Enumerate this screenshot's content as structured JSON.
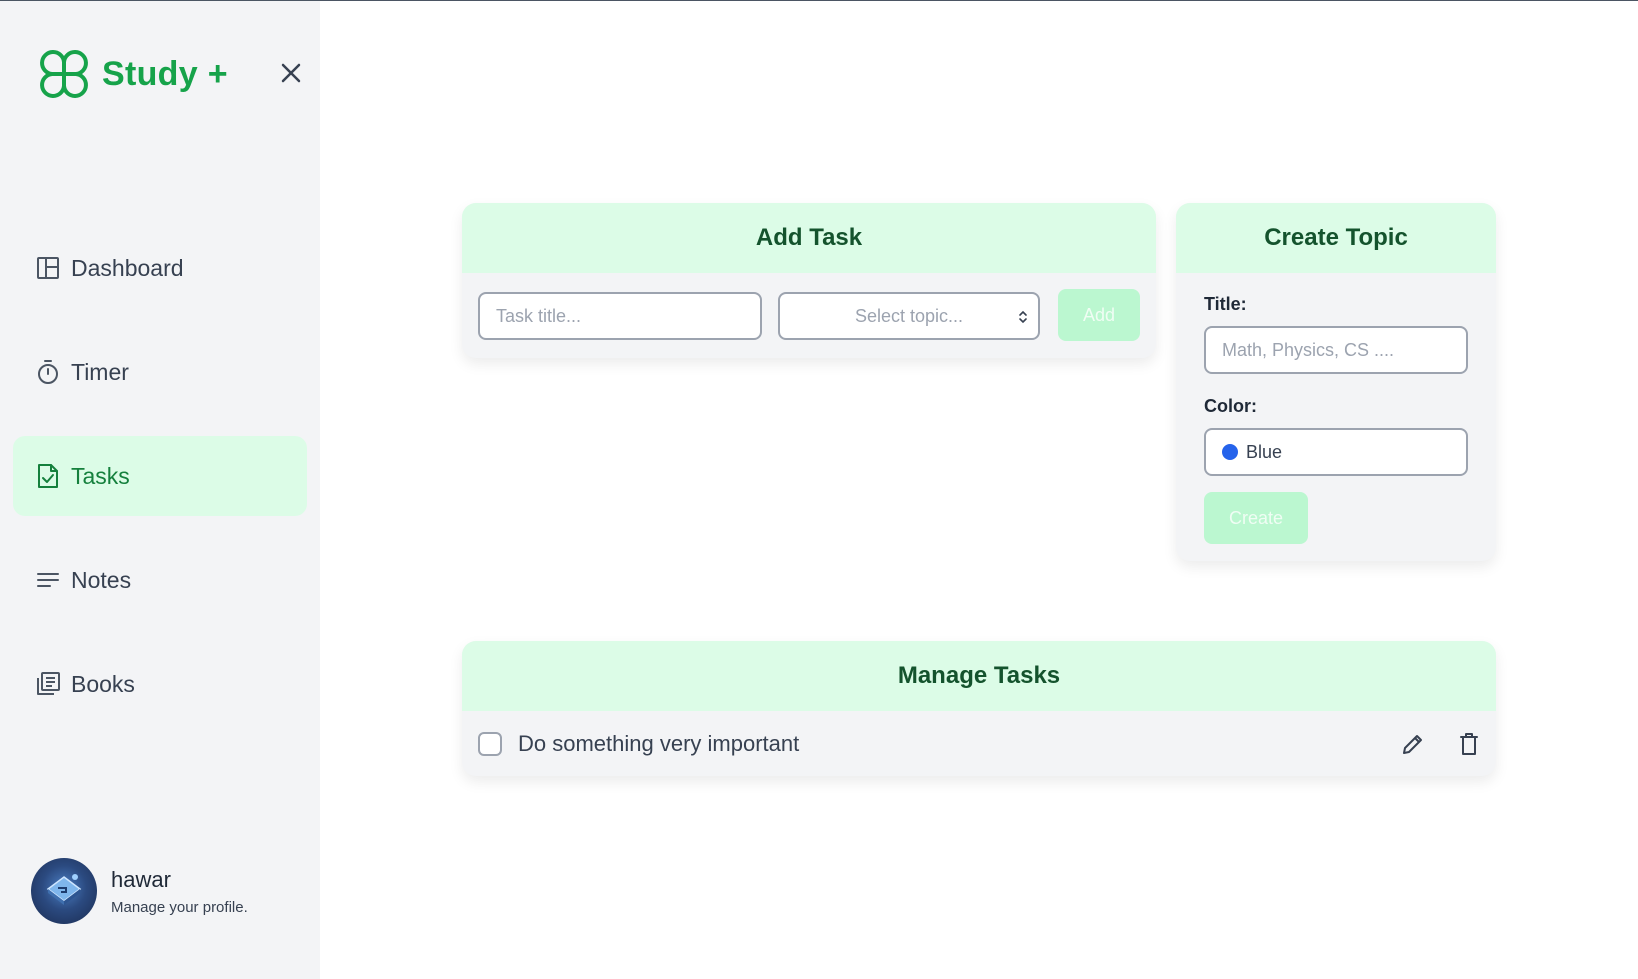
{
  "brand": {
    "name": "Study +",
    "color": "#16a34a"
  },
  "sidebar": {
    "items": [
      {
        "label": "Dashboard",
        "icon": "dashboard-layout-icon",
        "active": false
      },
      {
        "label": "Timer",
        "icon": "stopwatch-icon",
        "active": false
      },
      {
        "label": "Tasks",
        "icon": "file-check-icon",
        "active": true
      },
      {
        "label": "Notes",
        "icon": "lines-icon",
        "active": false
      },
      {
        "label": "Books",
        "icon": "library-icon",
        "active": false
      }
    ]
  },
  "profile": {
    "name": "hawar",
    "subtitle": "Manage your profile."
  },
  "add_task": {
    "title": "Add Task",
    "task_placeholder": "Task title...",
    "topic_placeholder": "Select topic...",
    "add_label": "Add"
  },
  "create_topic": {
    "title": "Create Topic",
    "title_label": "Title:",
    "title_placeholder": "Math, Physics, CS ....",
    "color_label": "Color:",
    "color_value": "Blue",
    "color_swatch": "#2563eb",
    "create_label": "Create"
  },
  "manage_tasks": {
    "title": "Manage Tasks",
    "tasks": [
      {
        "text": "Do something very important",
        "done": false
      }
    ]
  },
  "colors": {
    "accent": "#16a34a",
    "header_bg": "#dcfce7",
    "header_text": "#14532d"
  }
}
